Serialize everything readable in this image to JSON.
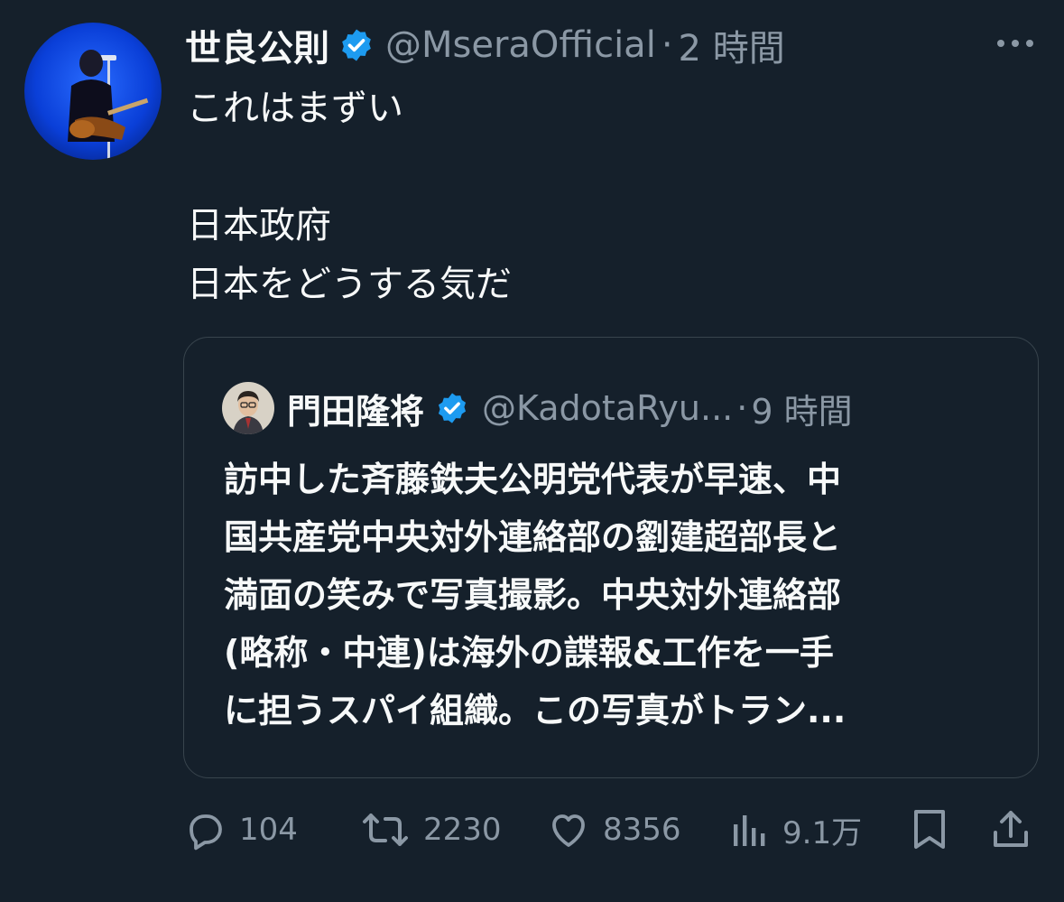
{
  "post": {
    "author_name": "世良公則",
    "handle": "@MseraOfficial",
    "separator": "·",
    "time": "2 時間",
    "body_lines": [
      "これはまずい",
      "",
      "日本政府",
      "日本をどうする気だ"
    ]
  },
  "quote": {
    "author_name": "門田隆将",
    "handle": "@KadotaRyu...",
    "separator": "·",
    "time": "9 時間",
    "text_lines": [
      "訪中した斉藤鉄夫公明党代表が早速、中",
      "国共産党中央対外連絡部の劉建超部長と",
      "満面の笑みで写真撮影。中央対外連絡部",
      "(略称・中連)は海外の諜報&工作を一手",
      "に担うスパイ組織。この写真がトラン..."
    ]
  },
  "actions": {
    "reply_count": "104",
    "repost_count": "2230",
    "like_count": "8356",
    "views_count": "9.1万"
  },
  "icons": {
    "verified": "verified-badge-icon",
    "more": "more-icon",
    "reply": "reply-icon",
    "repost": "repost-icon",
    "like": "heart-icon",
    "views": "views-icon",
    "bookmark": "bookmark-icon",
    "share": "share-icon"
  },
  "colors": {
    "background": "#15202b",
    "verified": "#1d9bf0",
    "text_primary": "#f7f9f9",
    "text_secondary": "#8b98a5",
    "border": "#38444d"
  }
}
